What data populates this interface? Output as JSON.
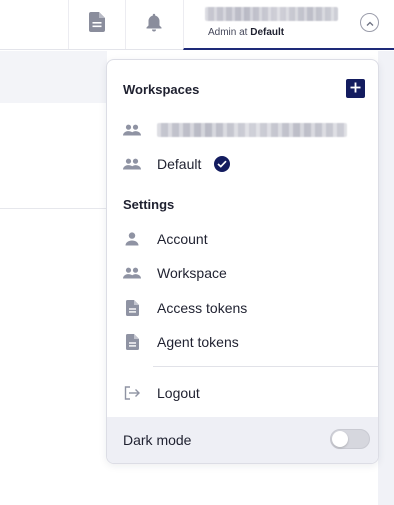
{
  "topbar": {
    "docs_icon": "document-icon",
    "notifications_icon": "bell-icon",
    "user": {
      "role_prefix": "Admin at",
      "workspace": "Default",
      "collapse_icon": "chevron-up-icon"
    }
  },
  "menu": {
    "workspaces_title": "Workspaces",
    "add_workspace_icon": "plus-icon",
    "workspaces": [
      {
        "icon": "group-icon",
        "label": ""
      },
      {
        "icon": "group-icon",
        "label": "Default",
        "selected": true
      }
    ],
    "settings_title": "Settings",
    "settings_items": [
      {
        "icon": "person-icon",
        "label": "Account"
      },
      {
        "icon": "group-icon",
        "label": "Workspace"
      },
      {
        "icon": "document-icon",
        "label": "Access tokens"
      },
      {
        "icon": "document-icon",
        "label": "Agent tokens"
      }
    ],
    "logout": {
      "icon": "logout-icon",
      "label": "Logout"
    },
    "dark_mode": {
      "label": "Dark mode",
      "enabled": false
    }
  },
  "colors": {
    "accent": "#131c5f",
    "icon_gray": "#8f93a3",
    "text": "#1f2130"
  }
}
